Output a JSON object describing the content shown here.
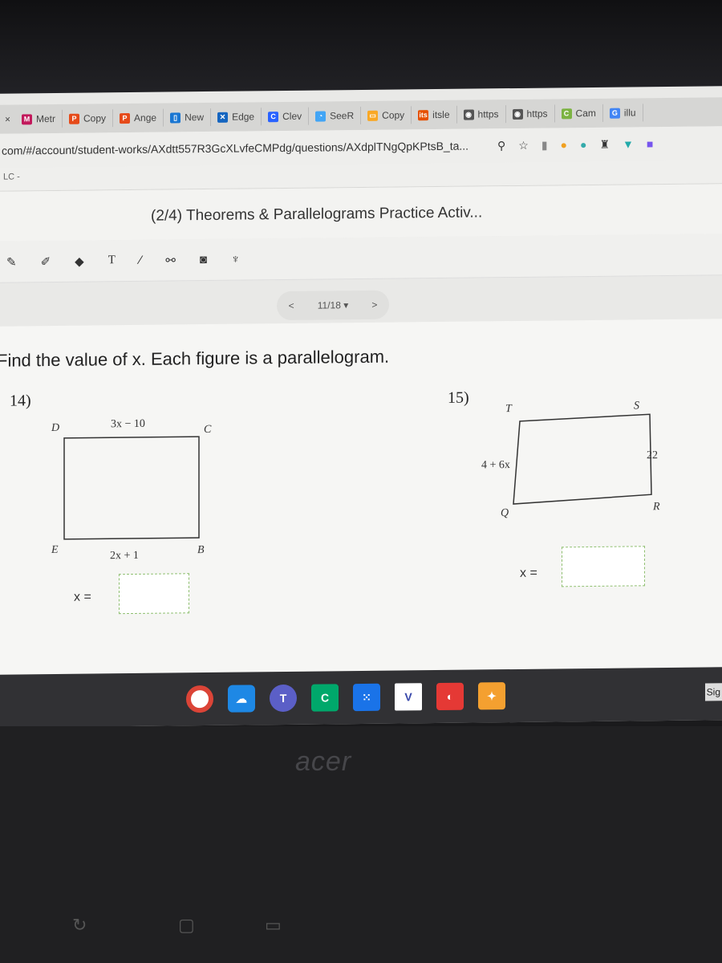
{
  "browser": {
    "tabs": [
      {
        "label": "Metr",
        "color": "#c2185b",
        "icon": "M"
      },
      {
        "label": "Copy",
        "color": "#e64a19",
        "icon": "P"
      },
      {
        "label": "Ange",
        "color": "#e64a19",
        "icon": "P"
      },
      {
        "label": "New",
        "color": "#1976d2",
        "icon": "▯"
      },
      {
        "label": "Edge",
        "color": "#1565c0",
        "icon": "✕"
      },
      {
        "label": "Clev",
        "color": "#2962ff",
        "icon": "C"
      },
      {
        "label": "SeeR",
        "color": "#42a5f5",
        "icon": "◔"
      },
      {
        "label": "Copy",
        "color": "#f9a825",
        "icon": "▭"
      },
      {
        "label": "itsle",
        "color": "#e65100",
        "icon": "its"
      },
      {
        "label": "https",
        "color": "#555555",
        "icon": "◉"
      },
      {
        "label": "https",
        "color": "#555555",
        "icon": "◉"
      },
      {
        "label": "Cam",
        "color": "#7cb342",
        "icon": "C"
      },
      {
        "label": "illu",
        "color": "#4285f4",
        "icon": "G"
      }
    ],
    "url": "com/#/account/student-works/AXdtt557R3GcXLvfeCMPdg/questions/AXdplTNgQpKPtsB_ta...",
    "bookmark": "LC -"
  },
  "activity": {
    "title": "(2/4) Theorems & Parallelograms Practice Activ...",
    "pager": {
      "prev": "<",
      "label": "11/18 ▾",
      "next": ">"
    }
  },
  "worksheet": {
    "instruction": "Find the value of x. Each figure is a parallelogram.",
    "problems": [
      {
        "number": "14)",
        "vertices": {
          "D": "D",
          "C": "C",
          "E": "E",
          "B": "B"
        },
        "top": "3x − 10",
        "bottom": "2x + 1",
        "answer_label": "x =",
        "answer": ""
      },
      {
        "number": "15)",
        "vertices": {
          "T": "T",
          "S": "S",
          "Q": "Q",
          "R": "R"
        },
        "left": "4 + 6x",
        "right": "22",
        "answer_label": "x =",
        "answer": ""
      }
    ]
  },
  "taskbar": {
    "sign": "Sig"
  },
  "laptop": {
    "brand": "acer"
  }
}
